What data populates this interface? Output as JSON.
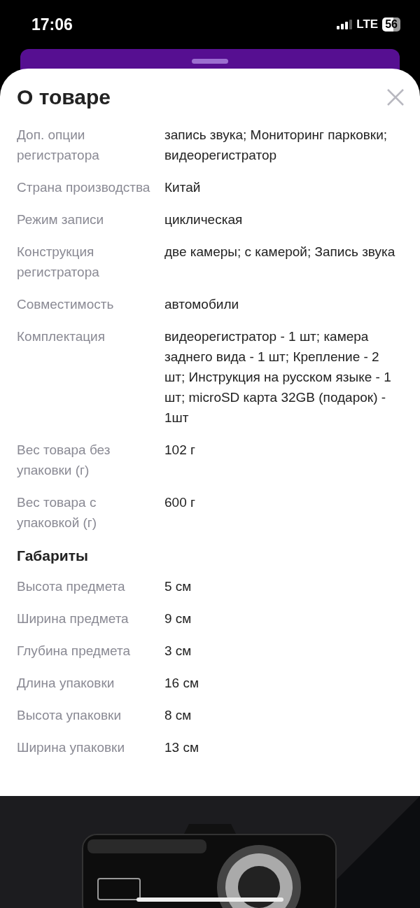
{
  "status_bar": {
    "time": "17:06",
    "network": "LTE",
    "battery": "56"
  },
  "sheet": {
    "title": "О товаре",
    "sections": [
      {
        "rows": [
          {
            "label": "Доп. опции регистратора",
            "value": "запись звука; Мониторинг парковки; видеорегистратор"
          },
          {
            "label": "Страна производства",
            "value": "Китай"
          },
          {
            "label": "Режим записи",
            "value": "циклическая"
          },
          {
            "label": "Конструкция регистратора",
            "value": "две камеры; с камерой; Запись звука"
          },
          {
            "label": "Совместимость",
            "value": "автомобили"
          },
          {
            "label": "Комплектация",
            "value": "видеорегистратор - 1 шт; камера заднего вида - 1 шт; Крепление - 2 шт; Инструкция на русском языке - 1 шт; microSD карта 32GB (подарок) - 1шт"
          },
          {
            "label": "Вес товара без упаковки (г)",
            "value": "102 г"
          },
          {
            "label": "Вес товара с упаковкой (г)",
            "value": "600 г"
          }
        ]
      },
      {
        "heading": "Габариты",
        "rows": [
          {
            "label": "Высота предмета",
            "value": "5 см"
          },
          {
            "label": "Ширина предмета",
            "value": "9 см"
          },
          {
            "label": "Глубина предмета",
            "value": "3 см"
          },
          {
            "label": "Длина упаковки",
            "value": "16 см"
          },
          {
            "label": "Высота упаковки",
            "value": "8 см"
          },
          {
            "label": "Ширина упаковки",
            "value": "13 см"
          }
        ]
      }
    ]
  }
}
